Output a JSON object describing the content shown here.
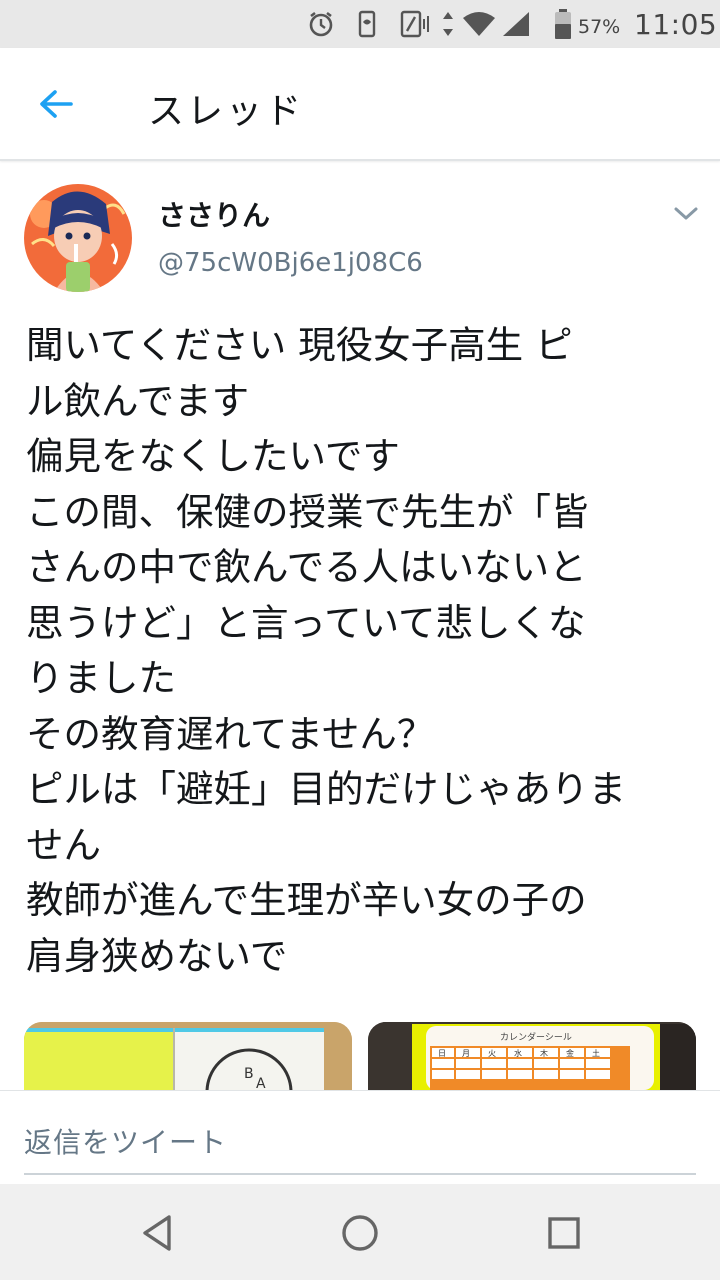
{
  "status_bar": {
    "battery_percent": "57%",
    "time": "11:05",
    "icons": [
      "alarm-icon",
      "vibrate-icon",
      "nfc-icon",
      "data-arrows-icon",
      "wifi-icon",
      "signal-icon",
      "battery-icon"
    ]
  },
  "header": {
    "title": "スレッド",
    "back_icon": "arrow-left-icon"
  },
  "tweet": {
    "display_name": "ささりん",
    "handle": "@75cW0Bj6e1j08C6",
    "text_lines": [
      "聞いてください 現役女子高生 ピ",
      "ル飲んでます",
      "偏見をなくしたいです",
      "この間、保健の授業で先生が「皆",
      "さんの中で飲んでる人はいないと",
      "思うけど」と言っていて悲しくな",
      "りました",
      "その教育遅れてません？",
      "ピルは「避妊」目的だけじゃありま",
      "せん",
      "教師が進んで生理が辛い女の子の",
      "肩身狭めないで"
    ],
    "media": [
      {
        "label": "BAYER",
        "description_icon": "pill-box-image"
      },
      {
        "label": "カレンダーシール",
        "days": [
          "日",
          "月",
          "火",
          "水",
          "木",
          "金",
          "土"
        ]
      }
    ]
  },
  "reply": {
    "placeholder": "返信をツイート"
  },
  "nav": {
    "buttons": [
      "back-triangle-icon",
      "home-circle-icon",
      "recents-square-icon"
    ]
  },
  "colors": {
    "accent": "#1da1f2",
    "secondary_text": "#657786",
    "primary_text": "#14171a"
  }
}
